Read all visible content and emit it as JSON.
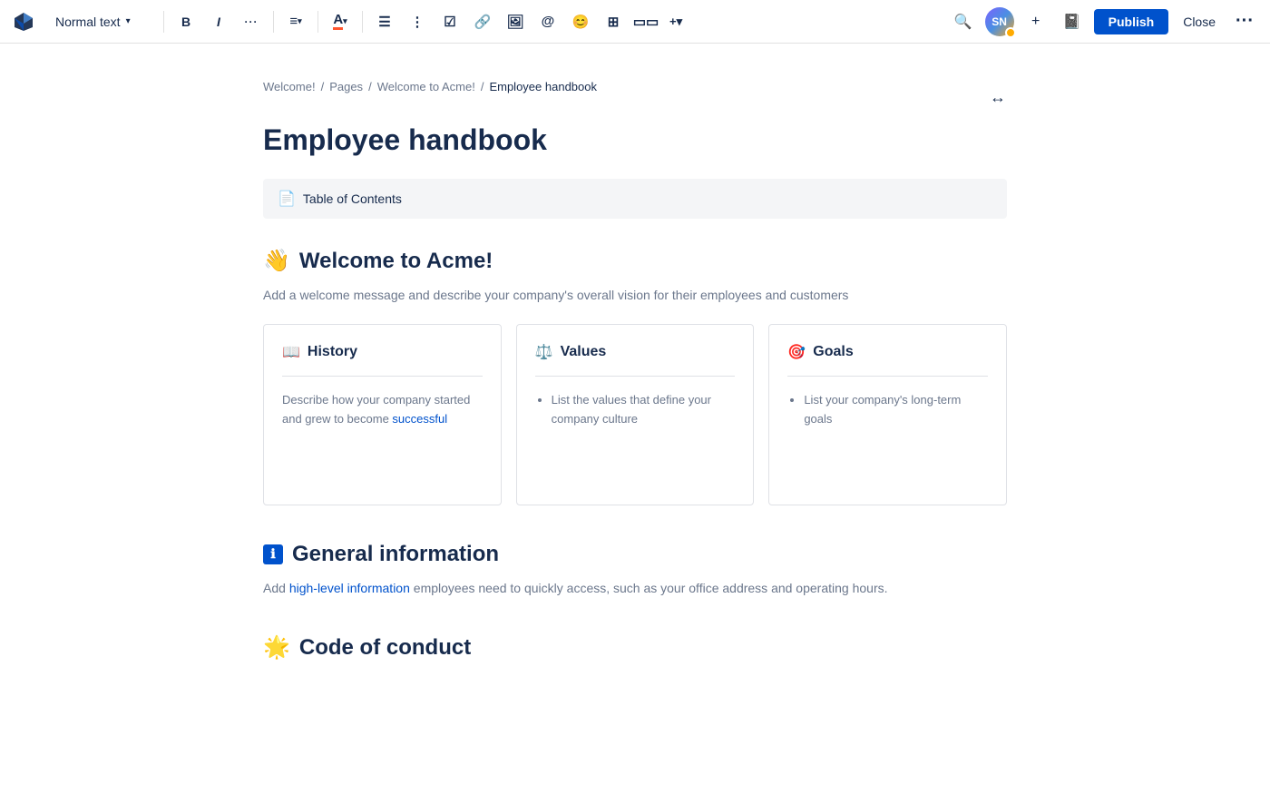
{
  "toolbar": {
    "text_style_label": "Normal text",
    "bold_label": "B",
    "italic_label": "I",
    "more_formatting_label": "···",
    "align_label": "≡",
    "color_label": "A",
    "bullet_list_label": "☰",
    "numbered_list_label": "⋮",
    "task_label": "☑",
    "link_label": "🔗",
    "image_label": "🖼",
    "mention_label": "@",
    "emoji_label": "😊",
    "table_label": "⊞",
    "layout_label": "⬜",
    "insert_label": "+▾",
    "search_label": "🔍",
    "avatar_text": "SN",
    "add_label": "+",
    "emoji_publish": "📓",
    "publish_label": "Publish",
    "close_label": "Close",
    "more_options_label": "···"
  },
  "breadcrumb": {
    "items": [
      {
        "label": "Welcome!"
      },
      {
        "label": "Pages"
      },
      {
        "label": "Welcome to Acme!"
      },
      {
        "label": "Employee handbook"
      }
    ],
    "expand_icon": "↔"
  },
  "page": {
    "title": "Employee handbook"
  },
  "toc": {
    "label": "Table of Contents",
    "icon": "📄"
  },
  "sections": [
    {
      "id": "welcome",
      "emoji": "👋",
      "heading": "Welcome to Acme!",
      "description": "Add a welcome message and describe your company's overall vision for their employees and customers",
      "cards": [
        {
          "emoji": "📖",
          "title": "History",
          "body_type": "text",
          "body": "Describe how your company started and grew to become successful"
        },
        {
          "emoji": "⚖️",
          "title": "Values",
          "body_type": "list",
          "items": [
            "List the values that define your company culture"
          ]
        },
        {
          "emoji": "🎯",
          "title": "Goals",
          "body_type": "list",
          "items": [
            "List your company's long-term goals"
          ]
        }
      ]
    },
    {
      "id": "general-info",
      "emoji": "ℹ️",
      "heading": "General information",
      "description": "Add high-level information employees need to quickly access, such as your office address and operating hours.",
      "description_link": "high-level information",
      "cards": []
    },
    {
      "id": "code-of-conduct",
      "emoji": "🌟",
      "heading": "Code of conduct",
      "description": "",
      "cards": []
    }
  ]
}
